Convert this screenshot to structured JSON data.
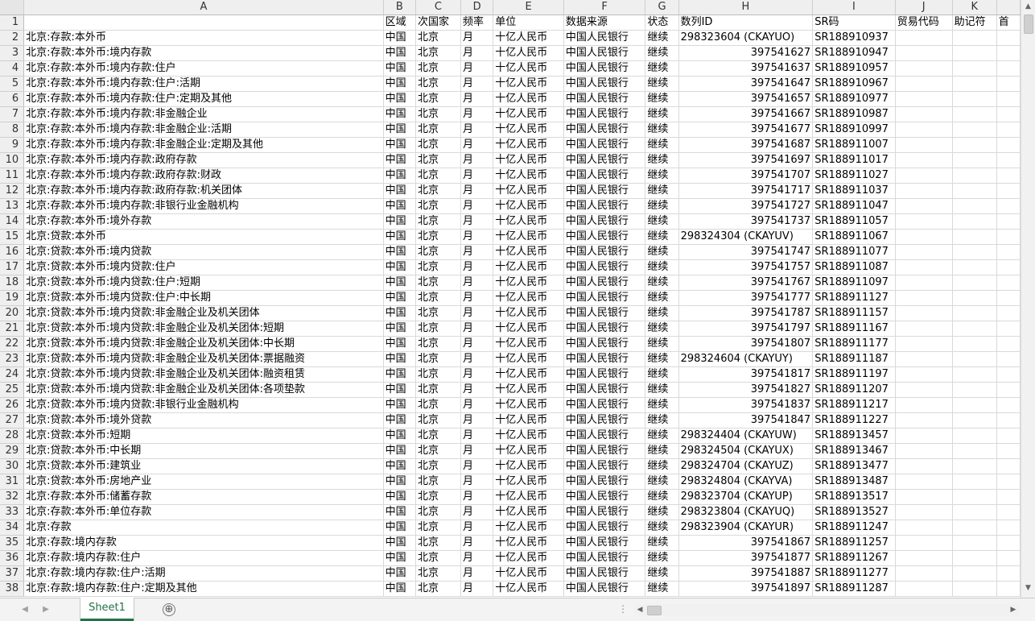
{
  "columns": [
    "A",
    "B",
    "C",
    "D",
    "E",
    "F",
    "G",
    "H",
    "I",
    "J",
    "K",
    ""
  ],
  "header_row": {
    "num": "1",
    "cells": [
      "",
      "区域",
      "次国家",
      "频率",
      "单位",
      "数据来源",
      "状态",
      "数列ID",
      "SR码",
      "贸易代码",
      "助记符",
      "首"
    ]
  },
  "rows": [
    {
      "num": "2",
      "name": "北京:存款:本外币",
      "id": "298323604 (CKAYUO)",
      "sr": "SR188910937"
    },
    {
      "num": "3",
      "name": "北京:存款:本外币:境内存款",
      "id": "397541627",
      "sr": "SR188910947"
    },
    {
      "num": "4",
      "name": "北京:存款:本外币:境内存款:住户",
      "id": "397541637",
      "sr": "SR188910957"
    },
    {
      "num": "5",
      "name": "北京:存款:本外币:境内存款:住户:活期",
      "id": "397541647",
      "sr": "SR188910967"
    },
    {
      "num": "6",
      "name": "北京:存款:本外币:境内存款:住户:定期及其他",
      "id": "397541657",
      "sr": "SR188910977"
    },
    {
      "num": "7",
      "name": "北京:存款:本外币:境内存款:非金融企业",
      "id": "397541667",
      "sr": "SR188910987"
    },
    {
      "num": "8",
      "name": "北京:存款:本外币:境内存款:非金融企业:活期",
      "id": "397541677",
      "sr": "SR188910997"
    },
    {
      "num": "9",
      "name": "北京:存款:本外币:境内存款:非金融企业:定期及其他",
      "id": "397541687",
      "sr": "SR188911007"
    },
    {
      "num": "10",
      "name": "北京:存款:本外币:境内存款:政府存款",
      "id": "397541697",
      "sr": "SR188911017"
    },
    {
      "num": "11",
      "name": "北京:存款:本外币:境内存款:政府存款:财政",
      "id": "397541707",
      "sr": "SR188911027"
    },
    {
      "num": "12",
      "name": "北京:存款:本外币:境内存款:政府存款:机关团体",
      "id": "397541717",
      "sr": "SR188911037"
    },
    {
      "num": "13",
      "name": "北京:存款:本外币:境内存款:非银行业金融机构",
      "id": "397541727",
      "sr": "SR188911047"
    },
    {
      "num": "14",
      "name": "北京:存款:本外币:境外存款",
      "id": "397541737",
      "sr": "SR188911057"
    },
    {
      "num": "15",
      "name": "北京:贷款:本外币",
      "id": "298324304 (CKAYUV)",
      "sr": "SR188911067"
    },
    {
      "num": "16",
      "name": "北京:贷款:本外币:境内贷款",
      "id": "397541747",
      "sr": "SR188911077"
    },
    {
      "num": "17",
      "name": "北京:贷款:本外币:境内贷款:住户",
      "id": "397541757",
      "sr": "SR188911087"
    },
    {
      "num": "18",
      "name": "北京:贷款:本外币:境内贷款:住户:短期",
      "id": "397541767",
      "sr": "SR188911097"
    },
    {
      "num": "19",
      "name": "北京:贷款:本外币:境内贷款:住户:中长期",
      "id": "397541777",
      "sr": "SR188911127"
    },
    {
      "num": "20",
      "name": "北京:贷款:本外币:境内贷款:非金融企业及机关团体",
      "id": "397541787",
      "sr": "SR188911157"
    },
    {
      "num": "21",
      "name": "北京:贷款:本外币:境内贷款:非金融企业及机关团体:短期",
      "id": "397541797",
      "sr": "SR188911167"
    },
    {
      "num": "22",
      "name": "北京:贷款:本外币:境内贷款:非金融企业及机关团体:中长期",
      "id": "397541807",
      "sr": "SR188911177"
    },
    {
      "num": "23",
      "name": "北京:贷款:本外币:境内贷款:非金融企业及机关团体:票据融资",
      "id": "298324604 (CKAYUY)",
      "sr": "SR188911187"
    },
    {
      "num": "24",
      "name": "北京:贷款:本外币:境内贷款:非金融企业及机关团体:融资租赁",
      "id": "397541817",
      "sr": "SR188911197"
    },
    {
      "num": "25",
      "name": "北京:贷款:本外币:境内贷款:非金融企业及机关团体:各项垫款",
      "id": "397541827",
      "sr": "SR188911207"
    },
    {
      "num": "26",
      "name": "北京:贷款:本外币:境内贷款:非银行业金融机构",
      "id": "397541837",
      "sr": "SR188911217"
    },
    {
      "num": "27",
      "name": "北京:贷款:本外币:境外贷款",
      "id": "397541847",
      "sr": "SR188911227"
    },
    {
      "num": "28",
      "name": "北京:贷款:本外币:短期",
      "id": "298324404 (CKAYUW)",
      "sr": "SR188913457"
    },
    {
      "num": "29",
      "name": "北京:贷款:本外币:中长期",
      "id": "298324504 (CKAYUX)",
      "sr": "SR188913467"
    },
    {
      "num": "30",
      "name": "北京:贷款:本外币:建筑业",
      "id": "298324704 (CKAYUZ)",
      "sr": "SR188913477"
    },
    {
      "num": "31",
      "name": "北京:贷款:本外币:房地产业",
      "id": "298324804 (CKAYVA)",
      "sr": "SR188913487"
    },
    {
      "num": "32",
      "name": "北京:存款:本外币:储蓄存款",
      "id": "298323704 (CKAYUP)",
      "sr": "SR188913517"
    },
    {
      "num": "33",
      "name": "北京:存款:本外币:单位存款",
      "id": "298323804 (CKAYUQ)",
      "sr": "SR188913527"
    },
    {
      "num": "34",
      "name": "北京:存款",
      "id": "298323904 (CKAYUR)",
      "sr": "SR188911247"
    },
    {
      "num": "35",
      "name": "北京:存款:境内存款",
      "id": "397541867",
      "sr": "SR188911257"
    },
    {
      "num": "36",
      "name": "北京:存款:境内存款:住户",
      "id": "397541877",
      "sr": "SR188911267"
    },
    {
      "num": "37",
      "name": "北京:存款:境内存款:住户:活期",
      "id": "397541887",
      "sr": "SR188911277"
    },
    {
      "num": "38",
      "name": "北京:存款:境内存款:住户:定期及其他",
      "id": "397541897",
      "sr": "SR188911287"
    }
  ],
  "common": {
    "region": "中国",
    "subcountry": "北京",
    "frequency": "月",
    "unit": "十亿人民币",
    "source": "中国人民银行",
    "status": "继续"
  },
  "sheet_tab": "Sheet1",
  "add_sheet": "⊕",
  "accent_color": "#217346"
}
